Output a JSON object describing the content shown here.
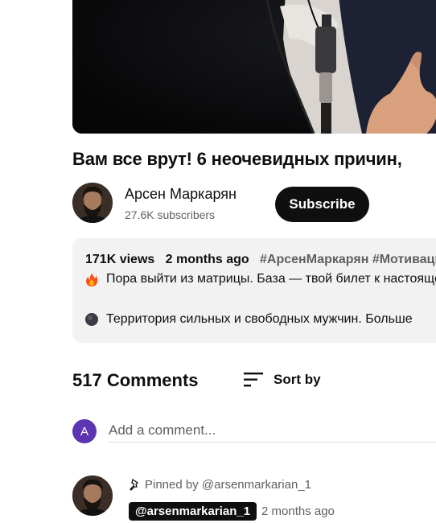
{
  "video": {
    "title": "Вам все врут! 6 неочевидных причин,"
  },
  "channel": {
    "name": "Арсен Маркарян",
    "subscribers": "27.6K subscribers",
    "subscribe_label": "Subscribe"
  },
  "description": {
    "views": "171K views",
    "age": "2 months ago",
    "tags": "#АрсенМаркарян #Мотивация",
    "line1_emoji": "fire-emoji",
    "line1": "Пора выйти из матрицы. База — твой билет к настоящей жизни",
    "line2_emoji": "black-circle-emoji",
    "line2": "Территория сильных и свободных мужчин. Больше"
  },
  "comments": {
    "count_label": "517 Comments",
    "sort_label": "Sort by",
    "user_avatar_letter": "A",
    "add_placeholder": "Add a comment...",
    "pinned_label": "Pinned by @arsenmarkarian_1",
    "pinned_author": "@arsenmarkarian_1",
    "pinned_time": "2 months ago"
  },
  "colors": {
    "subscribe_bg": "#0f0f0f",
    "user_avatar": "#5e35b1",
    "description_bg": "#f2f2f2",
    "secondary_text": "#606060"
  }
}
